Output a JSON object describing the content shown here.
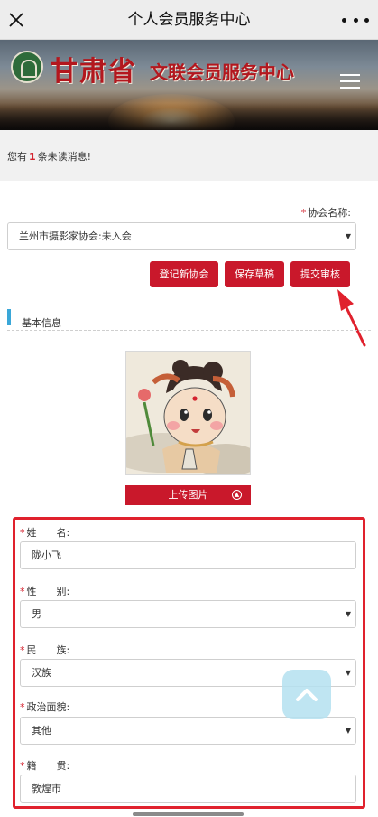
{
  "navbar": {
    "title": "个人会员服务中心",
    "close_icon": "close-icon",
    "more_icon": "more-dots-icon"
  },
  "banner": {
    "org_name": "甘肃省",
    "subtitle": "文联会员服务中心",
    "logo_icon": "emblem-logo",
    "menu_icon": "hamburger-menu-icon"
  },
  "notice": {
    "prefix": "您有",
    "count": "1",
    "suffix": "条未读消息!"
  },
  "association": {
    "required_mark": "*",
    "label": "协会名称:",
    "selected": "兰州市摄影家协会:未入会"
  },
  "actions": {
    "register_label": "登记新协会",
    "save_draft_label": "保存草稿",
    "submit_label": "提交审核"
  },
  "section": {
    "title": "基本信息"
  },
  "avatar": {
    "upload_label": "上传图片",
    "upload_icon": "upload-circle-icon"
  },
  "form": {
    "name": {
      "required_mark": "*",
      "label": "姓　　名:",
      "value": "陇小飞"
    },
    "gender": {
      "required_mark": "*",
      "label": "性　　别:",
      "value": "男"
    },
    "ethnicity": {
      "required_mark": "*",
      "label": "民　　族:",
      "value": "汉族"
    },
    "political": {
      "required_mark": "*",
      "label": "政治面貌:",
      "value": "其他"
    },
    "native_place": {
      "required_mark": "*",
      "label": "籍　　贯:",
      "value": "敦煌市"
    }
  },
  "colors": {
    "accent_red": "#c9182b",
    "highlight_red": "#e0212d",
    "section_blue": "#3aa7d8",
    "back_to_top_bg": "#b4e1f0"
  },
  "back_to_top_icon": "chevron-up-icon"
}
